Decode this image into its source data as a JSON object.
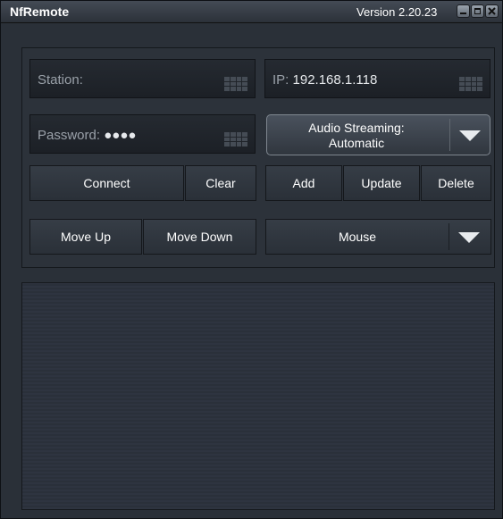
{
  "window": {
    "title": "NfRemote",
    "version": "Version 2.20.23"
  },
  "fields": {
    "station_label": "Station:",
    "station_value": "",
    "ip_label": "IP:",
    "ip_value": "192.168.1.118",
    "password_label": "Password:",
    "password_value": "●●●●"
  },
  "audio_streaming": {
    "label": "Audio Streaming:",
    "value": "Automatic"
  },
  "buttons": {
    "connect": "Connect",
    "clear": "Clear",
    "add": "Add",
    "update": "Update",
    "delete": "Delete",
    "move_up": "Move Up",
    "move_down": "Move Down"
  },
  "mouse_dropdown": {
    "value": "Mouse"
  },
  "icons": [
    "minimize-icon",
    "maximize-icon",
    "close-icon",
    "keyboard-icon",
    "chevron-down-icon"
  ]
}
